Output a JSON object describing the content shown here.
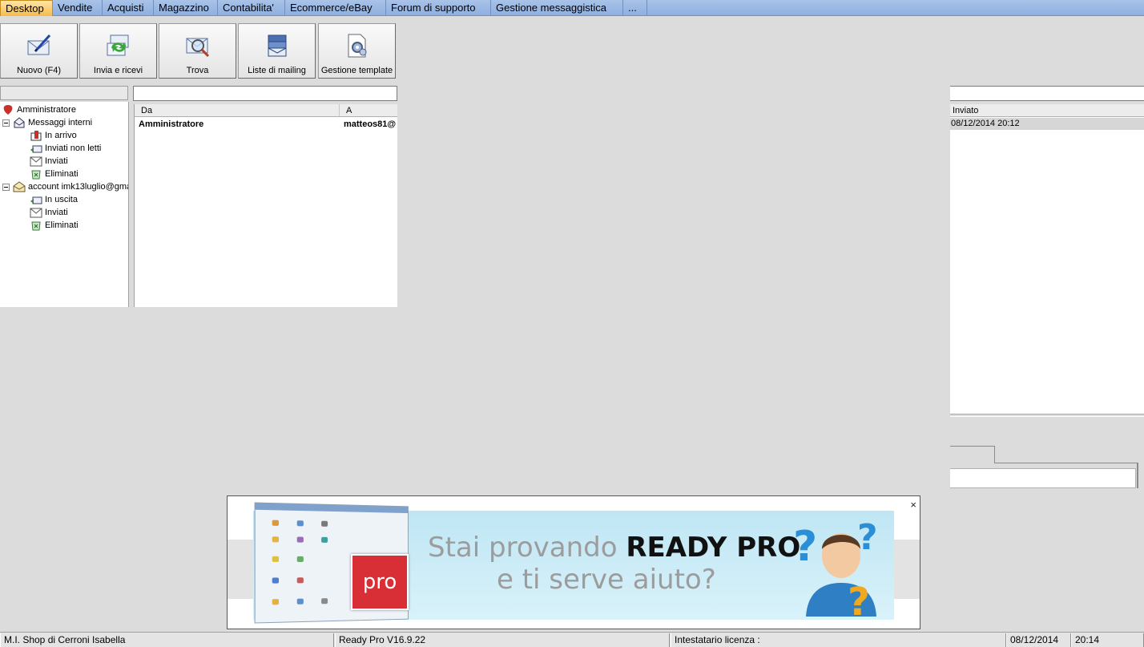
{
  "tabs": [
    "Desktop",
    "Vendite",
    "Acquisti",
    "Magazzino",
    "Contabilita'",
    "Ecommerce/eBay",
    "Forum di supporto",
    "Gestione messaggistica",
    "..."
  ],
  "toolbar": {
    "new_label": "Nuovo (F4)",
    "sendrecv_label": "Invia e ricevi",
    "find_label": "Trova",
    "mailing_label": "Liste di mailing",
    "templates_label": "Gestione template"
  },
  "tree": {
    "root": "Amministratore",
    "internal": "Messaggi interni",
    "in_arrivo": "In arrivo",
    "inviati_non_letti": "Inviati non letti",
    "inviati": "Inviati",
    "eliminati": "Eliminati",
    "account": "account imk13luglio@gma",
    "in_uscita": "In uscita",
    "acc_inviati": "Inviati",
    "acc_eliminati": "Eliminati"
  },
  "grid": {
    "col_da": "Da",
    "col_a": "A",
    "row_da": "Amministratore",
    "row_a": "matteos81@"
  },
  "right": {
    "col_inviato": "Inviato",
    "row_inviato": "08/12/2014 20:12"
  },
  "banner": {
    "line1_prefix": "Stai provando ",
    "line1_brand": "READY PRO",
    "line2": "e ti serve aiuto?",
    "logo_text": "pro",
    "close": "×"
  },
  "status": {
    "company": "M.I. Shop di Cerroni Isabella",
    "version": "Ready Pro V16.9.22",
    "license": "Intestatario licenza :",
    "date": "08/12/2014",
    "time": "20:14"
  },
  "colors": {
    "tab_active": "#f6bb4a",
    "tabbar": "#8fb0df",
    "logo_red": "#d72f35"
  }
}
